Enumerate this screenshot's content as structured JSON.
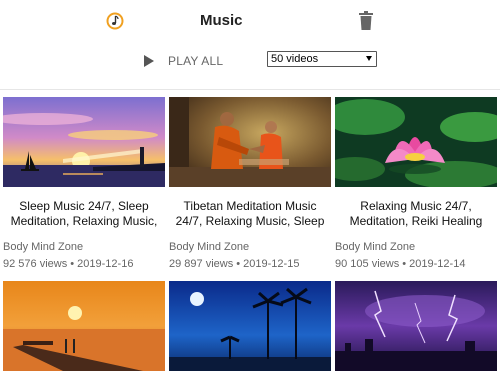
{
  "header": {
    "title": "Music"
  },
  "toolbar": {
    "play_all_label": "PLAY ALL",
    "select_value": "50 videos"
  },
  "videos": [
    {
      "title_line1": "Sleep Music 24/7, Sleep",
      "title_line2": "Meditation, Relaxing Music,",
      "channel": "Body Mind Zone",
      "meta": "92 576 views • 2019-12-16"
    },
    {
      "title_line1": "Tibetan Meditation Music",
      "title_line2": "24/7, Relaxing Music, Sleep",
      "channel": "Body Mind Zone",
      "meta": "29 897 views • 2019-12-15"
    },
    {
      "title_line1": "Relaxing Music 24/7,",
      "title_line2": "Meditation, Reiki Healing",
      "channel": "Body Mind Zone",
      "meta": "90 105 views • 2019-12-14"
    },
    {
      "title_line1": "",
      "title_line2": "",
      "channel": "",
      "meta": ""
    },
    {
      "title_line1": "",
      "title_line2": "",
      "channel": "",
      "meta": ""
    },
    {
      "title_line1": "",
      "title_line2": "",
      "channel": "",
      "meta": ""
    }
  ],
  "colors": {
    "accent_orange": "#f0a020",
    "text_muted": "#666666"
  },
  "icons": {
    "app": "music-note-icon",
    "trash": "trash-icon",
    "play": "play-icon",
    "dropdown": "chevron-down-icon"
  }
}
